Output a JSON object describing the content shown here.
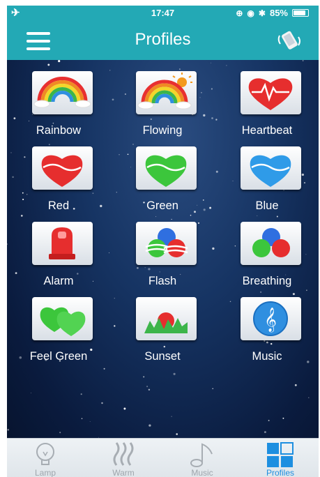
{
  "status_bar": {
    "time": "17:47",
    "battery": "85%",
    "battery_level": 0.85
  },
  "header": {
    "title": "Profiles",
    "menu_icon": "hamburger-menu-icon",
    "right_icon": "shake-phone-icon"
  },
  "profiles": [
    {
      "label": "Rainbow",
      "icon": "rainbow-icon"
    },
    {
      "label": "Flowing",
      "icon": "rainbow-sun-icon"
    },
    {
      "label": "Heartbeat",
      "icon": "heartbeat-heart-icon"
    },
    {
      "label": "Red",
      "icon": "red-heart-icon"
    },
    {
      "label": "Green",
      "icon": "green-heart-icon"
    },
    {
      "label": "Blue",
      "icon": "blue-heart-icon"
    },
    {
      "label": "Alarm",
      "icon": "alarm-light-icon"
    },
    {
      "label": "Flash",
      "icon": "flash-balls-icon"
    },
    {
      "label": "Breathing",
      "icon": "rgb-balls-icon"
    },
    {
      "label": "Feel Green",
      "icon": "green-hearts-icon"
    },
    {
      "label": "Sunset",
      "icon": "sunset-icon"
    },
    {
      "label": "Music",
      "icon": "music-note-icon"
    }
  ],
  "tabs": [
    {
      "label": "Lamp",
      "icon": "bulb-icon",
      "active": false
    },
    {
      "label": "Warm",
      "icon": "heat-waves-icon",
      "active": false
    },
    {
      "label": "Music",
      "icon": "music-note-outline-icon",
      "active": false
    },
    {
      "label": "Profiles",
      "icon": "grid-icon",
      "active": true
    }
  ],
  "colors": {
    "accent": "#23a9b5",
    "active_tab": "#1e8fe0",
    "inactive_tab": "#9ea5ac",
    "red": "#e62e2e",
    "green": "#3cc63c",
    "blue": "#2f9be8"
  }
}
